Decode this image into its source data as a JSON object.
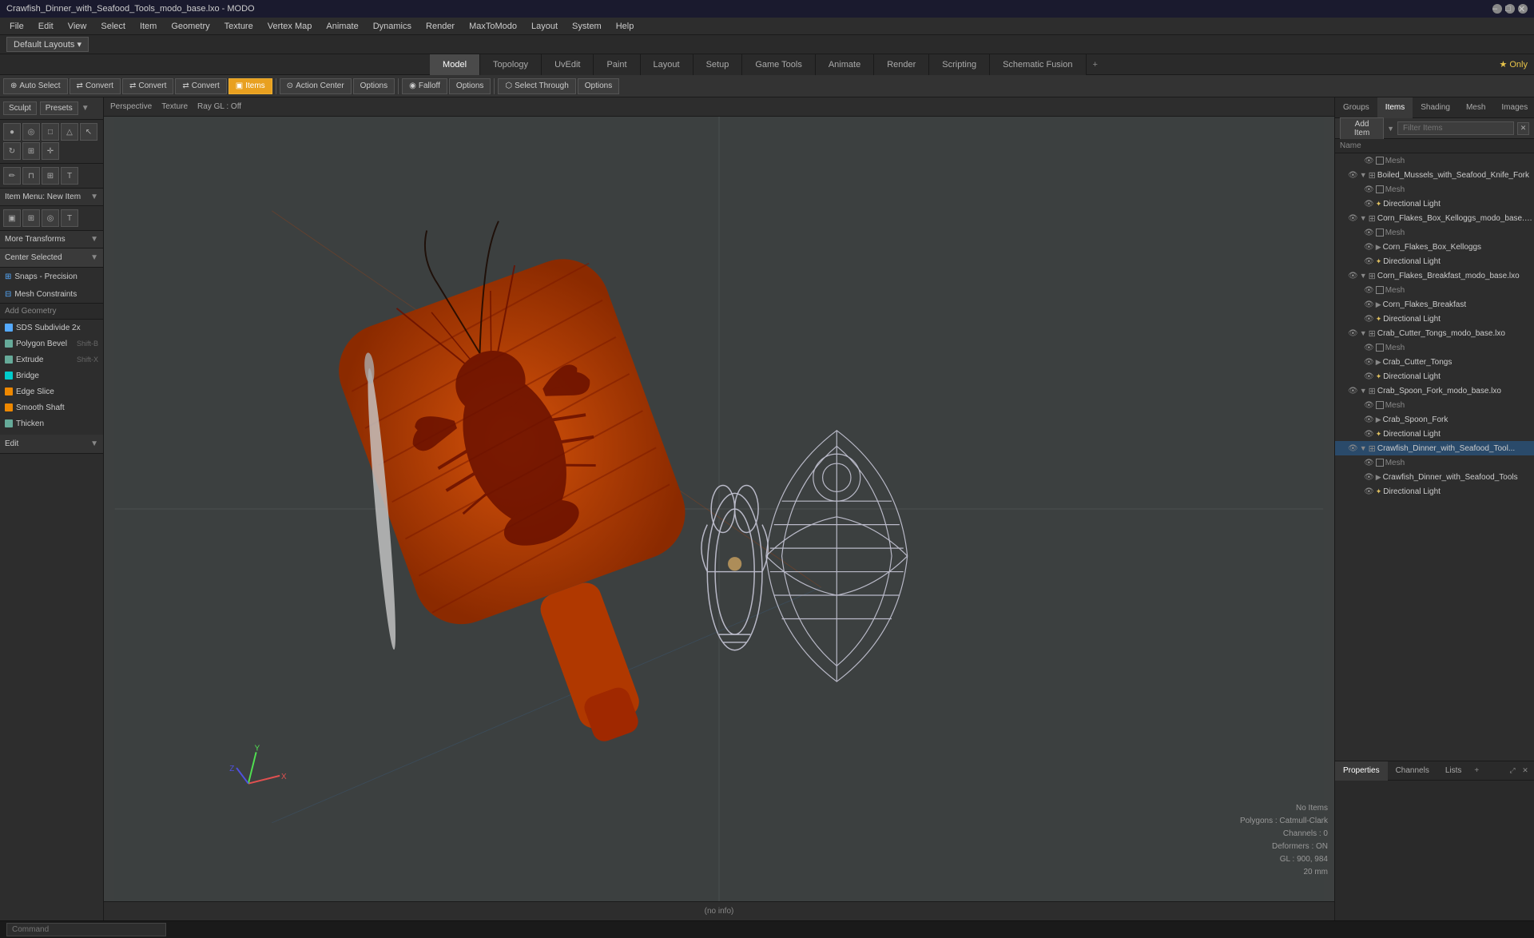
{
  "titlebar": {
    "title": "Crawfish_Dinner_with_Seafood_Tools_modo_base.lxo - MODO",
    "min": "–",
    "max": "□",
    "close": "✕"
  },
  "menubar": {
    "items": [
      "File",
      "Edit",
      "View",
      "Select",
      "Item",
      "Geometry",
      "Texture",
      "Vertex Map",
      "Animate",
      "Dynamics",
      "Render",
      "MaxToModo",
      "Layout",
      "System",
      "Help"
    ]
  },
  "layouts": {
    "label": "Default Layouts ▾"
  },
  "tabs": {
    "items": [
      "Model",
      "Topology",
      "UvEdit",
      "Paint",
      "Layout",
      "Setup",
      "Game Tools",
      "Animate",
      "Render",
      "Scripting",
      "Schematic Fusion"
    ],
    "active": "Model",
    "add": "+",
    "right_label": "★ Only"
  },
  "toolbar": {
    "buttons": [
      {
        "label": "Auto Select",
        "active": false
      },
      {
        "label": "Convert",
        "active": false
      },
      {
        "label": "Convert",
        "active": false
      },
      {
        "label": "Convert",
        "active": false
      },
      {
        "label": "Items",
        "active": true
      },
      {
        "label": "Action Center",
        "active": false
      },
      {
        "label": "Options",
        "active": false
      },
      {
        "label": "Falloff",
        "active": false
      },
      {
        "label": "Options",
        "active": false
      },
      {
        "label": "Select Through",
        "active": false
      },
      {
        "label": "Options",
        "active": false
      }
    ]
  },
  "left_panel": {
    "sculpt_label": "Sculpt",
    "presets_label": "Presets",
    "item_menu_label": "Item Menu: New Item",
    "more_transforms_label": "More Transforms",
    "center_selected_label": "Center Selected",
    "snaps_label": "Snaps - Precision",
    "mesh_constraints_label": "Mesh Constraints",
    "add_geometry_label": "Add Geometry",
    "geometry_items": [
      {
        "label": "SDS Subdivide 2x",
        "shortcut": "",
        "color": "blue"
      },
      {
        "label": "Polygon Bevel",
        "shortcut": "Shift-B",
        "color": "green"
      },
      {
        "label": "Extrude",
        "shortcut": "Shift-X",
        "color": "green"
      },
      {
        "label": "Bridge",
        "shortcut": "",
        "color": "cyan"
      },
      {
        "label": "Edge Slice",
        "shortcut": "",
        "color": "orange"
      },
      {
        "label": "Smooth Shaft",
        "shortcut": "",
        "color": "orange"
      },
      {
        "label": "Thicken",
        "shortcut": "",
        "color": "green"
      }
    ],
    "edit_label": "Edit"
  },
  "viewport": {
    "perspective": "Perspective",
    "texture": "Texture",
    "ray": "Ray GL : Off",
    "bottom_info": "(no info)",
    "stats": {
      "no_items": "No Items",
      "polygons": "Polygons : Catmull-Clark",
      "channels": "Channels : 0",
      "deformers": "Deformers : ON",
      "gl": "GL : 900, 984",
      "zoom": "20 mm"
    }
  },
  "right_panel": {
    "tabs": [
      "Groups",
      "Items",
      "Shading",
      "Mesh",
      "Images"
    ],
    "active_tab": "Items",
    "add_item_label": "Add Item",
    "filter_label": "Filter Items",
    "col_name": "Name",
    "tree": [
      {
        "level": 1,
        "type": "mesh",
        "label": "Mesh",
        "visible": true,
        "indent": 2
      },
      {
        "level": 1,
        "type": "item",
        "label": "Boiled_Mussels_with_Seafood_Knife_Fork",
        "visible": true,
        "indent": 1,
        "collapsed": false
      },
      {
        "level": 2,
        "type": "mesh",
        "label": "Mesh",
        "visible": true,
        "indent": 2
      },
      {
        "level": 2,
        "type": "light",
        "label": "Directional Light",
        "visible": true,
        "indent": 2
      },
      {
        "level": 1,
        "type": "item",
        "label": "Corn_Flakes_Box_Kelloggs_modo_base.lxo",
        "visible": true,
        "indent": 1,
        "collapsed": false
      },
      {
        "level": 2,
        "type": "mesh",
        "label": "Mesh",
        "visible": true,
        "indent": 2
      },
      {
        "level": 2,
        "type": "item",
        "label": "Corn_Flakes_Box_Kelloggs",
        "visible": true,
        "indent": 2
      },
      {
        "level": 2,
        "type": "light",
        "label": "Directional Light",
        "visible": true,
        "indent": 2
      },
      {
        "level": 1,
        "type": "item",
        "label": "Corn_Flakes_Breakfast_modo_base.lxo",
        "visible": true,
        "indent": 1,
        "collapsed": false
      },
      {
        "level": 2,
        "type": "mesh",
        "label": "Mesh",
        "visible": true,
        "indent": 2
      },
      {
        "level": 2,
        "type": "item",
        "label": "Corn_Flakes_Breakfast",
        "visible": true,
        "indent": 2
      },
      {
        "level": 2,
        "type": "light",
        "label": "Directional Light",
        "visible": true,
        "indent": 2
      },
      {
        "level": 1,
        "type": "item",
        "label": "Crab_Cutter_Tongs_modo_base.lxo",
        "visible": true,
        "indent": 1,
        "collapsed": false
      },
      {
        "level": 2,
        "type": "mesh",
        "label": "Mesh",
        "visible": true,
        "indent": 2
      },
      {
        "level": 2,
        "type": "item",
        "label": "Crab_Cutter_Tongs",
        "visible": true,
        "indent": 2
      },
      {
        "level": 2,
        "type": "light",
        "label": "Directional Light",
        "visible": true,
        "indent": 2
      },
      {
        "level": 1,
        "type": "item",
        "label": "Crab_Spoon_Fork_modo_base.lxo",
        "visible": true,
        "indent": 1,
        "collapsed": false
      },
      {
        "level": 2,
        "type": "mesh",
        "label": "Mesh",
        "visible": true,
        "indent": 2
      },
      {
        "level": 2,
        "type": "item",
        "label": "Crab_Spoon_Fork",
        "visible": true,
        "indent": 2
      },
      {
        "level": 2,
        "type": "light",
        "label": "Directional Light",
        "visible": true,
        "indent": 2
      },
      {
        "level": 1,
        "type": "item",
        "label": "Crawfish_Dinner_with_Seafood_Tool...",
        "visible": true,
        "indent": 1,
        "collapsed": false,
        "selected": true
      },
      {
        "level": 2,
        "type": "mesh",
        "label": "Mesh",
        "visible": true,
        "indent": 2
      },
      {
        "level": 2,
        "type": "item",
        "label": "Crawfish_Dinner_with_Seafood_Tools",
        "visible": true,
        "indent": 2
      },
      {
        "level": 2,
        "type": "light",
        "label": "Directional Light",
        "visible": true,
        "indent": 2
      }
    ]
  },
  "properties_panel": {
    "tabs": [
      "Properties",
      "Channels",
      "Lists"
    ],
    "active_tab": "Properties",
    "add": "+"
  },
  "command_bar": {
    "placeholder": "Command"
  }
}
